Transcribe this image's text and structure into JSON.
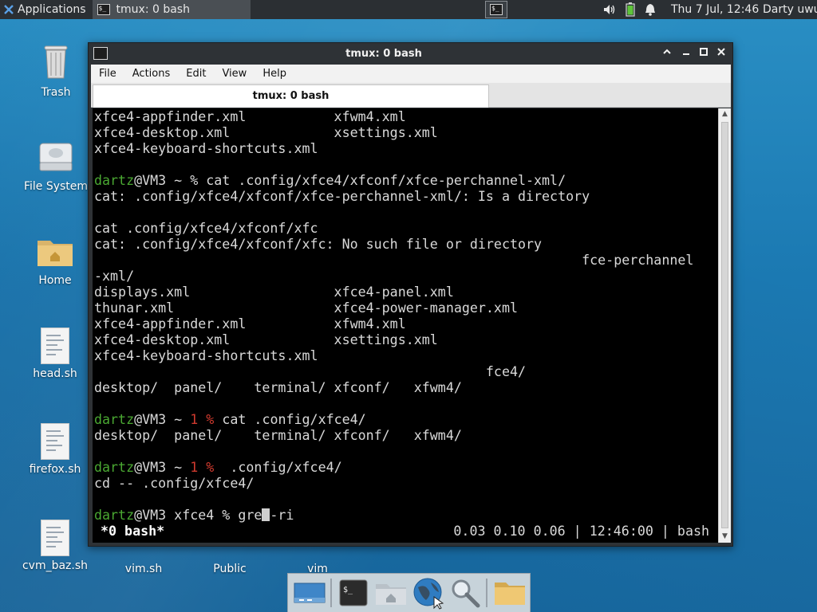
{
  "top_panel": {
    "applications_label": "Applications",
    "taskbar_window_label": "tmux: 0 bash",
    "clock": "Thu  7 Jul, 12:46",
    "user": "Darty uwu"
  },
  "desktop": {
    "icons": [
      {
        "label": "Trash"
      },
      {
        "label": "File System"
      },
      {
        "label": "Home"
      },
      {
        "label": "head.sh"
      },
      {
        "label": "firefox.sh"
      },
      {
        "label": "cvm_baz.sh"
      },
      {
        "label": "vim.sh"
      },
      {
        "label": "Public"
      },
      {
        "label": "vim"
      }
    ]
  },
  "window": {
    "title": "tmux: 0 bash",
    "menu": [
      "File",
      "Actions",
      "Edit",
      "View",
      "Help"
    ],
    "tab_label": "tmux: 0 bash"
  },
  "terminal": {
    "lines": [
      {
        "segments": [
          {
            "t": "xfce4-appfinder.xml           xfwm4.xml"
          }
        ]
      },
      {
        "segments": [
          {
            "t": "xfce4-desktop.xml             xsettings.xml"
          }
        ]
      },
      {
        "segments": [
          {
            "t": "xfce4-keyboard-shortcuts.xml"
          }
        ]
      },
      {
        "segments": [
          {
            "t": ""
          }
        ]
      },
      {
        "segments": [
          {
            "t": "dartz",
            "c": "green"
          },
          {
            "t": "@VM3 ~ % cat .config/xfce4/xfconf/xfce-perchannel-xml/"
          }
        ]
      },
      {
        "segments": [
          {
            "t": "cat: .config/xfce4/xfconf/xfce-perchannel-xml/: Is a directory"
          }
        ]
      },
      {
        "segments": [
          {
            "t": ""
          }
        ]
      },
      {
        "segments": [
          {
            "t": "cat .config/xfce4/xfconf/xfc"
          }
        ]
      },
      {
        "segments": [
          {
            "t": "cat: .config/xfce4/xfconf/xfc: No such file or directory"
          }
        ]
      },
      {
        "segments": [
          {
            "t": "                                                             fce-perchannel"
          }
        ]
      },
      {
        "segments": [
          {
            "t": "-xml/"
          }
        ]
      },
      {
        "segments": [
          {
            "t": "displays.xml                  xfce4-panel.xml"
          }
        ]
      },
      {
        "segments": [
          {
            "t": "thunar.xml                    xfce4-power-manager.xml"
          }
        ]
      },
      {
        "segments": [
          {
            "t": "xfce4-appfinder.xml           xfwm4.xml"
          }
        ]
      },
      {
        "segments": [
          {
            "t": "xfce4-desktop.xml             xsettings.xml"
          }
        ]
      },
      {
        "segments": [
          {
            "t": "xfce4-keyboard-shortcuts.xml"
          }
        ]
      },
      {
        "segments": [
          {
            "t": "                                                 fce4/"
          }
        ]
      },
      {
        "segments": [
          {
            "t": "desktop/  panel/    terminal/ xfconf/   xfwm4/"
          }
        ]
      },
      {
        "segments": [
          {
            "t": ""
          }
        ]
      },
      {
        "segments": [
          {
            "t": "dartz",
            "c": "green"
          },
          {
            "t": "@VM3 ~ "
          },
          {
            "t": "1",
            "c": "red"
          },
          {
            "t": " "
          },
          {
            "t": "%",
            "c": "red"
          },
          {
            "t": " cat .config/xfce4/"
          }
        ]
      },
      {
        "segments": [
          {
            "t": "desktop/  panel/    terminal/ xfconf/   xfwm4/"
          }
        ]
      },
      {
        "segments": [
          {
            "t": ""
          }
        ]
      },
      {
        "segments": [
          {
            "t": "dartz",
            "c": "green"
          },
          {
            "t": "@VM3 ~ "
          },
          {
            "t": "1",
            "c": "red"
          },
          {
            "t": " "
          },
          {
            "t": "%",
            "c": "red"
          },
          {
            "t": "  .config/xfce4/"
          }
        ]
      },
      {
        "segments": [
          {
            "t": "cd -- .config/xfce4/"
          }
        ]
      },
      {
        "segments": [
          {
            "t": ""
          }
        ]
      },
      {
        "segments": [
          {
            "t": "dartz",
            "c": "green"
          },
          {
            "t": "@VM3 xfce4 % gre"
          },
          {
            "cursor": true
          },
          {
            "t": "-ri"
          }
        ]
      }
    ],
    "status_left": "*0 bash*",
    "status_right": "0.03 0.10 0.06 | 12:46:00 | bash"
  },
  "dock": {
    "items": [
      "show-desktop",
      "terminal",
      "home-folder",
      "web-browser",
      "app-finder",
      "files"
    ]
  },
  "colors": {
    "prompt_user": "#4aa832",
    "prompt_error": "#d03a2e",
    "desktop_bg": "#1b79b2"
  }
}
